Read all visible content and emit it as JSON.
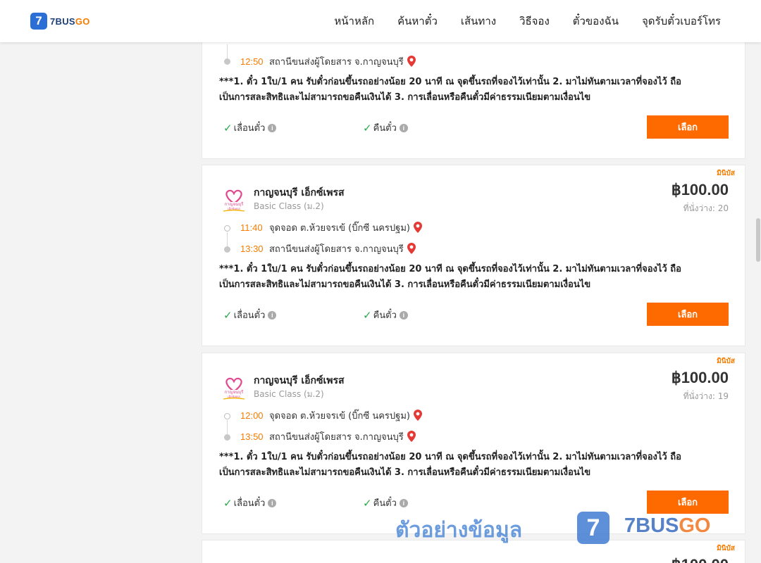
{
  "header": {
    "logo": {
      "digit": "7",
      "text_main": "7BUS",
      "text_accent": "GO"
    },
    "nav": [
      "หน้าหลัก",
      "ค้นหาตั๋ว",
      "เส้นทาง",
      "วิธีจอง",
      "ตั๋วของฉัน",
      "จุดรับตั๋วเบอร์โทร"
    ]
  },
  "colors": {
    "accent": "#ff6a00",
    "time": "#f57c00",
    "check": "#2aa84a",
    "brand_blue": "#2b6fd6"
  },
  "common": {
    "notice_line1": "***1. ตั๋ว 1ใบ/1 คน รับตั๋วก่อนขึ้นรถอย่างน้อย 20 นาที ณ จุดขึ้นรถที่จองไว้เท่านั้น 2. มาไม่ทันตามเวลาที่จองไว้ ถือ",
    "notice_line2": "เป็นการสละสิทธิและไม่สามารถขอคืนเงินได้ 3. การเลื่อนหรือคืนตั๋วมีค่าธรรมเนียมตามเงื่อนไข",
    "reschedule": "เลื่อนตั๋ว",
    "refund": "คืนตั๋ว",
    "select": "เลือก",
    "info_icon": "i",
    "check_icon": "✓"
  },
  "top_card": {
    "arrive_time": "12:50",
    "arrive_place": "สถานีขนส่งผู้โดยสาร จ.กาญจนบุรี"
  },
  "trips": [
    {
      "tag": "มินิบัส",
      "operator": "กาญจนบุรี เอ็กซ์เพรส",
      "bus_class": "Basic Class (ม.2)",
      "price": "฿100.00",
      "seats": "ที่นั่งว่าง: 20",
      "depart_time": "11:40",
      "depart_place": "จุดจอด ต.ห้วยจรเข้ (บิ๊กซี นครปฐม)",
      "arrive_time": "13:30",
      "arrive_place": "สถานีขนส่งผู้โดยสาร จ.กาญจนบุรี"
    },
    {
      "tag": "มินิบัส",
      "operator": "กาญจนบุรี เอ็กซ์เพรส",
      "bus_class": "Basic Class (ม.2)",
      "price": "฿100.00",
      "seats": "ที่นั่งว่าง: 19",
      "depart_time": "12:00",
      "depart_place": "จุดจอด ต.ห้วยจรเข้ (บิ๊กซี นครปฐม)",
      "arrive_time": "13:50",
      "arrive_place": "สถานีขนส่งผู้โดยสาร จ.กาญจนบุรี"
    },
    {
      "tag": "มินิบัส",
      "price": "฿100.00"
    }
  ],
  "watermark": {
    "text": "ตัวอย่างข้อมูล",
    "badge": "7",
    "brand_main": "7BUS",
    "brand_accent": "GO"
  }
}
